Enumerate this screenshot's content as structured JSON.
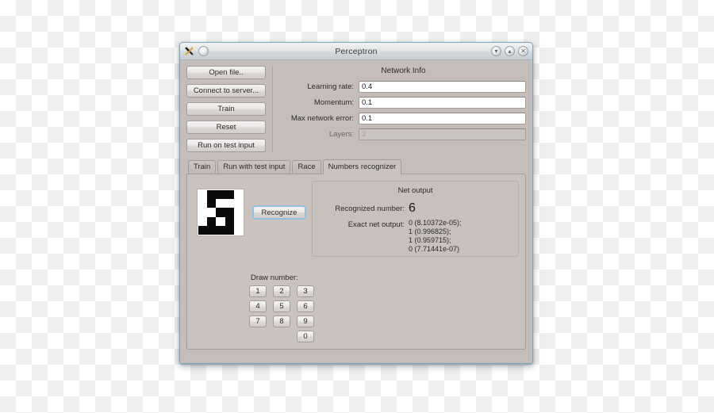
{
  "window": {
    "title": "Perceptron",
    "app_icon": "scissors-x-icon",
    "menu_button_icon": "window-menu-icon",
    "controls": [
      {
        "name": "minimize",
        "icon": "chevron-down-icon",
        "glyph": "▾"
      },
      {
        "name": "maximize",
        "icon": "chevron-up-icon",
        "glyph": "▴"
      },
      {
        "name": "close",
        "icon": "close-x-icon",
        "glyph": "✕"
      }
    ]
  },
  "actions": {
    "buttons": [
      {
        "label": "Open file..",
        "name": "open-file-button"
      },
      {
        "label": "Connect to server...",
        "name": "connect-to-server-button"
      },
      {
        "label": "Train",
        "name": "train-button"
      },
      {
        "label": "Reset",
        "name": "reset-button"
      },
      {
        "label": "Run on test input",
        "name": "run-on-test-input-button"
      }
    ]
  },
  "network_info": {
    "title": "Network Info",
    "fields": [
      {
        "label": "Learning rate:",
        "value": "0.4",
        "disabled": false,
        "name": "learning-rate"
      },
      {
        "label": "Momentum:",
        "value": "0.1",
        "disabled": false,
        "name": "momentum"
      },
      {
        "label": "Max network error:",
        "value": "0.1",
        "disabled": false,
        "name": "max-network-error"
      },
      {
        "label": "Layers:",
        "value": "3",
        "disabled": true,
        "name": "layers"
      }
    ]
  },
  "tabs": {
    "items": [
      {
        "label": "Train",
        "selected": false
      },
      {
        "label": "Run with test input",
        "selected": false
      },
      {
        "label": "Race",
        "selected": false
      },
      {
        "label": "Numbers recognizer",
        "selected": true
      }
    ]
  },
  "recognizer": {
    "recognize_button_label": "Recognize",
    "grid": {
      "columns": 5,
      "rows": 5,
      "pixels": [
        [
          0,
          1,
          1,
          1,
          0
        ],
        [
          0,
          1,
          0,
          0,
          0
        ],
        [
          0,
          0,
          1,
          1,
          0
        ],
        [
          0,
          1,
          0,
          1,
          0
        ],
        [
          1,
          1,
          1,
          1,
          0
        ]
      ],
      "on_color": "#0a0a0a",
      "off_color": "#ffffff"
    },
    "net_output": {
      "title": "Net output",
      "recognized_label": "Recognized number:",
      "recognized_value": "6",
      "exact_label": "Exact net output:",
      "exact_value": "0 (8.10372e-05);\n1 (0.996825);\n1 (0.959715);\n0 (7.71441e-07)"
    },
    "draw_number": {
      "label": "Draw number:",
      "keys": [
        "1",
        "2",
        "3",
        "4",
        "5",
        "6",
        "7",
        "8",
        "9",
        "",
        "",
        "0"
      ]
    }
  },
  "colors": {
    "window_bg": "#c4bdba",
    "panel_bg": "#c9c2bf",
    "window_border": "#7fa6bd",
    "focus_ring": "#8fc2de",
    "text": "#2d2b2a"
  }
}
